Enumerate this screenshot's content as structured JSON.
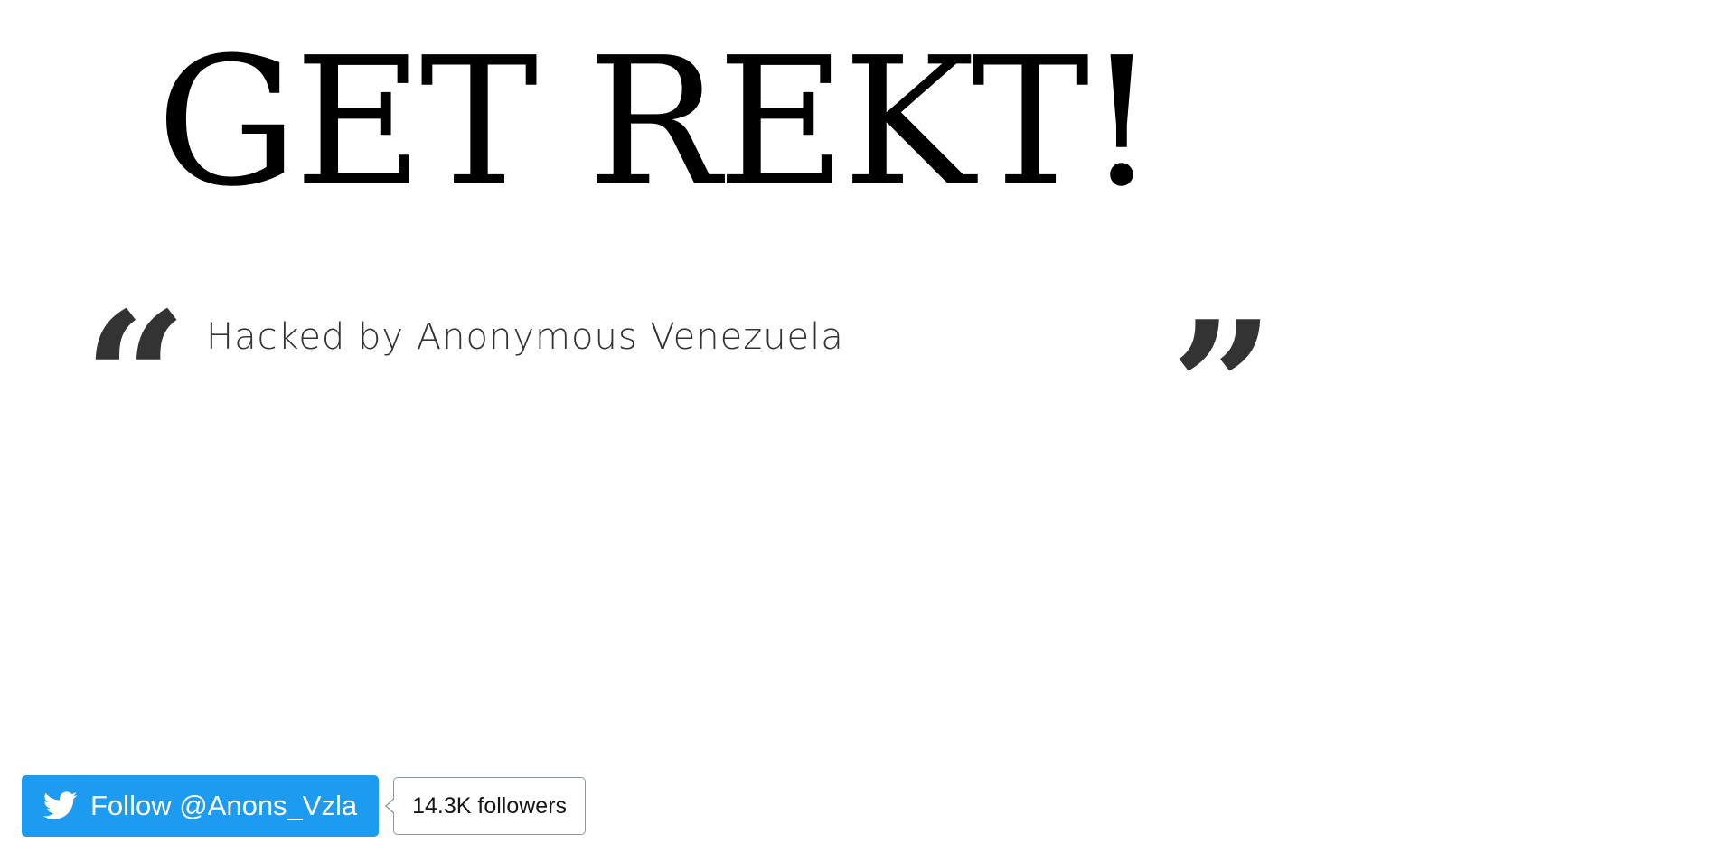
{
  "headline": "GET REKT!",
  "quote": {
    "open_mark": "“",
    "text": "Hacked by Anonymous Venezuela",
    "close_mark": "”"
  },
  "twitter": {
    "follow_label": "Follow @Anons_Vzla",
    "followers_label": "14.3K followers",
    "icon": "twitter-bird-icon",
    "brand_color": "#1d9bf0"
  }
}
